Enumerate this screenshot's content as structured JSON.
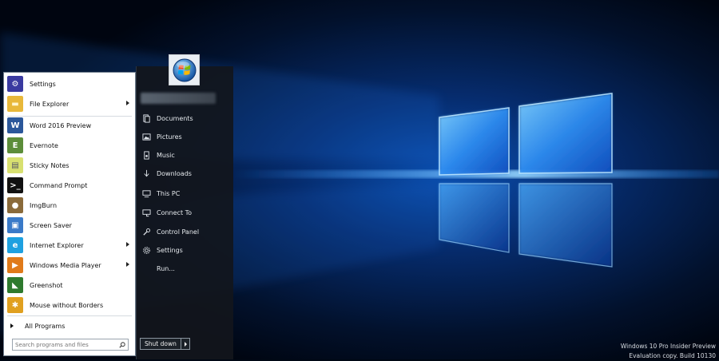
{
  "start_menu": {
    "pinned": [
      {
        "label": "Settings",
        "icon": "gear-icon",
        "color": "#3a3aa0",
        "arrow": false
      },
      {
        "label": "File Explorer",
        "icon": "folder-icon",
        "color": "#e8b83a",
        "arrow": true
      },
      {
        "label": "Word 2016 Preview",
        "icon": "word-icon",
        "color": "#2b579a",
        "arrow": false
      },
      {
        "label": "Evernote",
        "icon": "evernote-icon",
        "color": "#5c8d3a",
        "arrow": false
      },
      {
        "label": "Sticky Notes",
        "icon": "sticky-notes-icon",
        "color": "#d8e070",
        "arrow": false
      },
      {
        "label": "Command Prompt",
        "icon": "command-prompt-icon",
        "color": "#111111",
        "arrow": false
      },
      {
        "label": "ImgBurn",
        "icon": "imgburn-icon",
        "color": "#8a6a3a",
        "arrow": false
      },
      {
        "label": "Screen Saver",
        "icon": "screen-saver-icon",
        "color": "#3a7ac8",
        "arrow": false
      },
      {
        "label": "Internet Explorer",
        "icon": "internet-explorer-icon",
        "color": "#1ea0e0",
        "arrow": true
      },
      {
        "label": "Windows Media Player",
        "icon": "media-player-icon",
        "color": "#e07a1a",
        "arrow": true
      },
      {
        "label": "Greenshot",
        "icon": "greenshot-icon",
        "color": "#2e7a2e",
        "arrow": false
      },
      {
        "label": "Mouse without Borders",
        "icon": "mouse-without-borders-icon",
        "color": "#e0a020",
        "arrow": false
      }
    ],
    "all_programs_label": "All Programs",
    "search_placeholder": "Search programs and files",
    "places": [
      {
        "label": "Documents",
        "icon": "documents-icon"
      },
      {
        "label": "Pictures",
        "icon": "pictures-icon"
      },
      {
        "label": "Music",
        "icon": "music-icon"
      },
      {
        "label": "Downloads",
        "icon": "downloads-icon"
      },
      {
        "label": "This PC",
        "icon": "this-pc-icon"
      },
      {
        "label": "Connect To",
        "icon": "connect-to-icon"
      },
      {
        "label": "Control Panel",
        "icon": "control-panel-icon"
      },
      {
        "label": "Settings",
        "icon": "gear-icon"
      },
      {
        "label": "Run...",
        "icon": "run-icon"
      }
    ],
    "shutdown_label": "Shut down"
  },
  "watermark": {
    "line1": "Windows 10 Pro Insider Preview",
    "line2": "Evaluation copy. Build 10130"
  },
  "colors": {
    "desktop_bg": "#000814",
    "glow": "#1e8cff",
    "menu_left_bg": "#ffffff",
    "menu_right_bg": "#12161c"
  }
}
